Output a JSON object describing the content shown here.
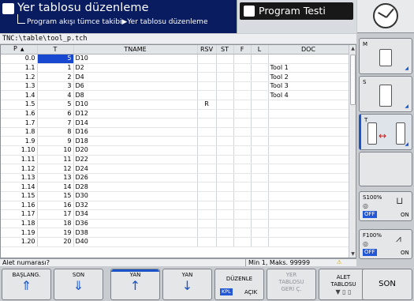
{
  "header": {
    "title": "Yer tablosu düzenleme",
    "breadcrumb": "Program akışı tümce takibi▶Yer tablosu düzenleme",
    "second_tab": "Program Testi"
  },
  "path": "TNC:\\table\\tool_p.tch",
  "table": {
    "columns": [
      "P",
      "T",
      "TNAME",
      "RSV",
      "ST",
      "F",
      "L",
      "DOC"
    ],
    "rows": [
      {
        "p": "0.0",
        "t": "5",
        "tname": "D10",
        "rsv": "",
        "doc": ""
      },
      {
        "p": "1.1",
        "t": "1",
        "tname": "D2",
        "rsv": "",
        "doc": "Tool 1"
      },
      {
        "p": "1.2",
        "t": "2",
        "tname": "D4",
        "rsv": "",
        "doc": "Tool 2"
      },
      {
        "p": "1.3",
        "t": "3",
        "tname": "D6",
        "rsv": "",
        "doc": "Tool 3"
      },
      {
        "p": "1.4",
        "t": "4",
        "tname": "D8",
        "rsv": "",
        "doc": "Tool 4"
      },
      {
        "p": "1.5",
        "t": "5",
        "tname": "D10",
        "rsv": "R",
        "doc": ""
      },
      {
        "p": "1.6",
        "t": "6",
        "tname": "D12",
        "rsv": "",
        "doc": ""
      },
      {
        "p": "1.7",
        "t": "7",
        "tname": "D14",
        "rsv": "",
        "doc": ""
      },
      {
        "p": "1.8",
        "t": "8",
        "tname": "D16",
        "rsv": "",
        "doc": ""
      },
      {
        "p": "1.9",
        "t": "9",
        "tname": "D18",
        "rsv": "",
        "doc": ""
      },
      {
        "p": "1.10",
        "t": "10",
        "tname": "D20",
        "rsv": "",
        "doc": ""
      },
      {
        "p": "1.11",
        "t": "11",
        "tname": "D22",
        "rsv": "",
        "doc": ""
      },
      {
        "p": "1.12",
        "t": "12",
        "tname": "D24",
        "rsv": "",
        "doc": ""
      },
      {
        "p": "1.13",
        "t": "13",
        "tname": "D26",
        "rsv": "",
        "doc": ""
      },
      {
        "p": "1.14",
        "t": "14",
        "tname": "D28",
        "rsv": "",
        "doc": ""
      },
      {
        "p": "1.15",
        "t": "15",
        "tname": "D30",
        "rsv": "",
        "doc": ""
      },
      {
        "p": "1.16",
        "t": "16",
        "tname": "D32",
        "rsv": "",
        "doc": ""
      },
      {
        "p": "1.17",
        "t": "17",
        "tname": "D34",
        "rsv": "",
        "doc": ""
      },
      {
        "p": "1.18",
        "t": "18",
        "tname": "D36",
        "rsv": "",
        "doc": ""
      },
      {
        "p": "1.19",
        "t": "19",
        "tname": "D38",
        "rsv": "",
        "doc": ""
      },
      {
        "p": "1.20",
        "t": "20",
        "tname": "D40",
        "rsv": "",
        "doc": ""
      }
    ],
    "selected_row": 0
  },
  "status": {
    "prompt": "Alet numarası?",
    "range": "Min 1, Maks. 99999"
  },
  "right_softkeys": {
    "m_label": "M",
    "s_label": "S",
    "t_label": "T",
    "spindle_override": "S100%",
    "feed_override": "F100%",
    "off": "OFF",
    "on": "ON"
  },
  "softkeys": {
    "baslang": "BAŞLANG.",
    "son1": "SON",
    "yan1": "YAN",
    "yan2": "YAN",
    "duzenle": "DÜZENLE",
    "kpl": "KPL",
    "acik": "AÇIK",
    "yer_1": "YER",
    "yer_2": "TABLOSU",
    "yer_3": "GERİ Ç.",
    "alet_1": "ALET",
    "alet_2": "TABLOSU",
    "son2": "SON"
  }
}
